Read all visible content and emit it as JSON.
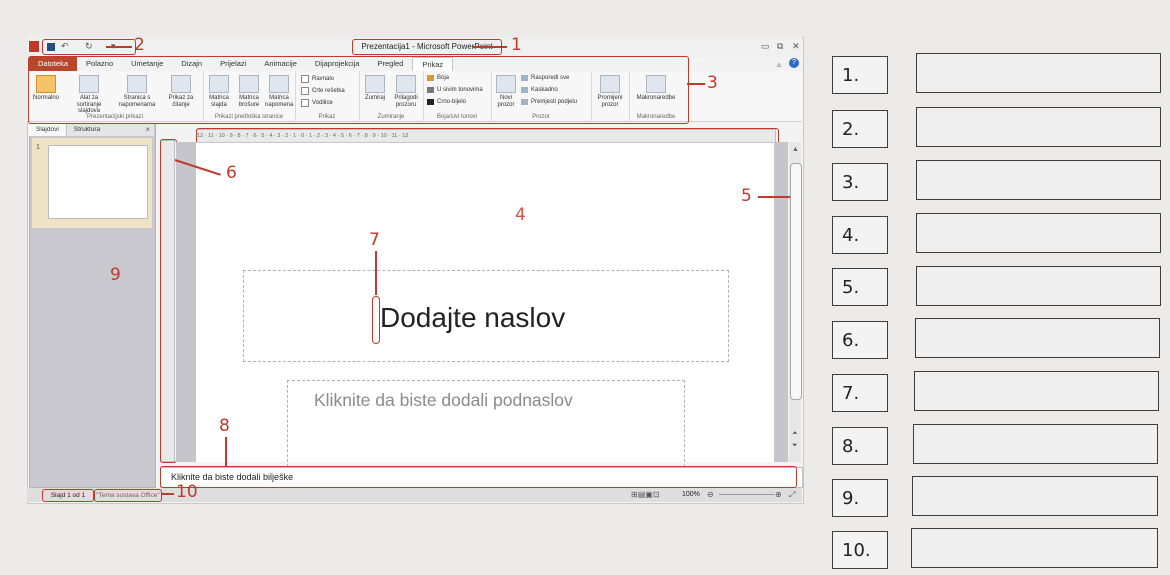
{
  "window": {
    "title": "Prezentacija1 - Microsoft PowerPoint",
    "quick_access_icons": [
      "save-icon",
      "undo-icon",
      "redo-icon",
      "customize-icon"
    ],
    "controls": [
      "minimize-icon",
      "restore-icon",
      "close-icon",
      "help-icon"
    ]
  },
  "ribbon": {
    "tabs": [
      "Datoteka",
      "Polazno",
      "Umetanje",
      "Dizajn",
      "Prijelazi",
      "Animacije",
      "Dijaprojekcija",
      "Pregled",
      "Prikaz"
    ],
    "active_tab": "Prikaz",
    "groups": [
      {
        "name": "Prezentacijski prikazi",
        "buttons": [
          "Normalno",
          "Alat za sortiranje slajdova",
          "Stranica s napomenama",
          "Prikaz za čitanje"
        ]
      },
      {
        "name": "Prikazi predloška stranice",
        "buttons": [
          "Matrica slajda",
          "Matrica brošure",
          "Matrica napomena"
        ]
      },
      {
        "name": "Prikaz",
        "checkboxes": [
          "Ravnalo",
          "Crte rešetka",
          "Vodilice"
        ]
      },
      {
        "name": "Zumiranje",
        "buttons": [
          "Zumiraj",
          "Prilagodi prozoru"
        ]
      },
      {
        "name": "Boja/sivi tonovi",
        "items": [
          "Boja",
          "U sivim tonovima",
          "Crno-bijelo"
        ]
      },
      {
        "name": "Prozor",
        "buttons": [
          "Novi prozor"
        ],
        "items": [
          "Rasporedi sve",
          "Kaskadno",
          "Premjesti podjelu"
        ]
      },
      {
        "name": "",
        "buttons": [
          "Promijeni prozor"
        ]
      },
      {
        "name": "Makronaredbe",
        "buttons": [
          "Makronaredbe"
        ]
      }
    ]
  },
  "left_pane": {
    "tabs": [
      "Slajdovi",
      "Struktura"
    ],
    "close_label": "×",
    "thumb_number": "1"
  },
  "ruler": "12 · 11 · 10 · 9 · 8 · 7 · 6 · 5 · 4 · 3 · 2 · 1 · 0 · 1 · 2 · 3 · 4 · 5 · 6 · 7 · 8 · 9 · 10 · 11 · 12",
  "slide": {
    "title_placeholder": "Dodajte naslov",
    "subtitle_placeholder": "Kliknite da biste dodali podnaslov"
  },
  "notes": {
    "placeholder": "Kliknite da biste dodali bilješke"
  },
  "status": {
    "slide": "Slajd 1 od 1",
    "theme": "\"Tema sustava Office\"",
    "zoom": "100%"
  },
  "callouts": [
    "1",
    "2",
    "3",
    "4",
    "5",
    "6",
    "7",
    "8",
    "9",
    "10"
  ],
  "answers": [
    {
      "num": "1."
    },
    {
      "num": "2."
    },
    {
      "num": "3."
    },
    {
      "num": "4."
    },
    {
      "num": "5."
    },
    {
      "num": "6."
    },
    {
      "num": "7."
    },
    {
      "num": "8."
    },
    {
      "num": "9."
    },
    {
      "num": "10."
    }
  ],
  "colors": {
    "accent": "#c0392b",
    "file_tab": "#b7472a",
    "pane": "#c9c8ce"
  }
}
